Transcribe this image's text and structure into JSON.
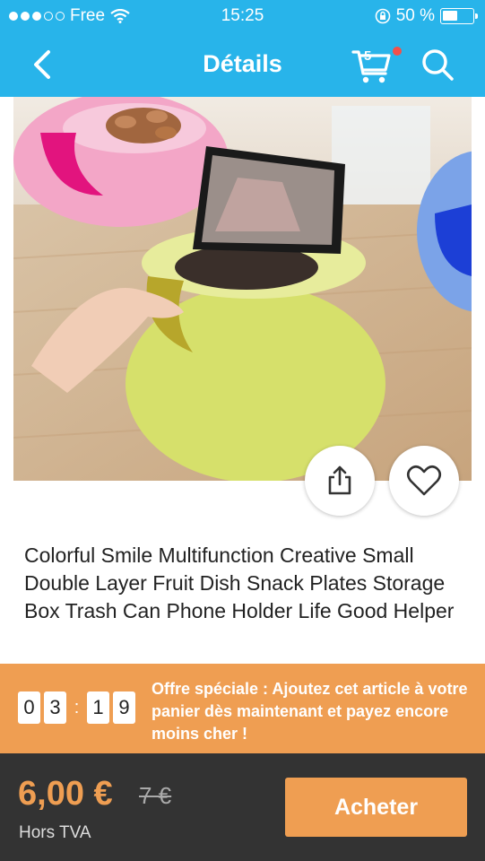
{
  "status_bar": {
    "carrier": "Free",
    "time": "15:25",
    "battery_text": "50 %",
    "battery_level": 0.5
  },
  "nav": {
    "title": "Détails",
    "cart_count": "5",
    "icons": [
      "chevron-left-icon",
      "cart-icon",
      "search-icon"
    ]
  },
  "product": {
    "title": "Colorful Smile Multifunction Creative Small Double Layer Fruit Dish Snack Plates Storage Box Trash Can Phone Holder Life Good Helper"
  },
  "offer": {
    "timer_digits": [
      "0",
      "3",
      "1",
      "9"
    ],
    "separator": ":",
    "text": "Offre spéciale : Ajoutez cet article à votre panier dès maintenant et payez encore moins cher !"
  },
  "purchase": {
    "price": "6,00 €",
    "old_price": "7 €",
    "tax_note": "Hors TVA",
    "buy_label": "Acheter"
  },
  "colors": {
    "header": "#28b4ea",
    "accent": "#ef9e52",
    "bottom_bar": "#333333",
    "badge_dot": "#f3504a"
  }
}
